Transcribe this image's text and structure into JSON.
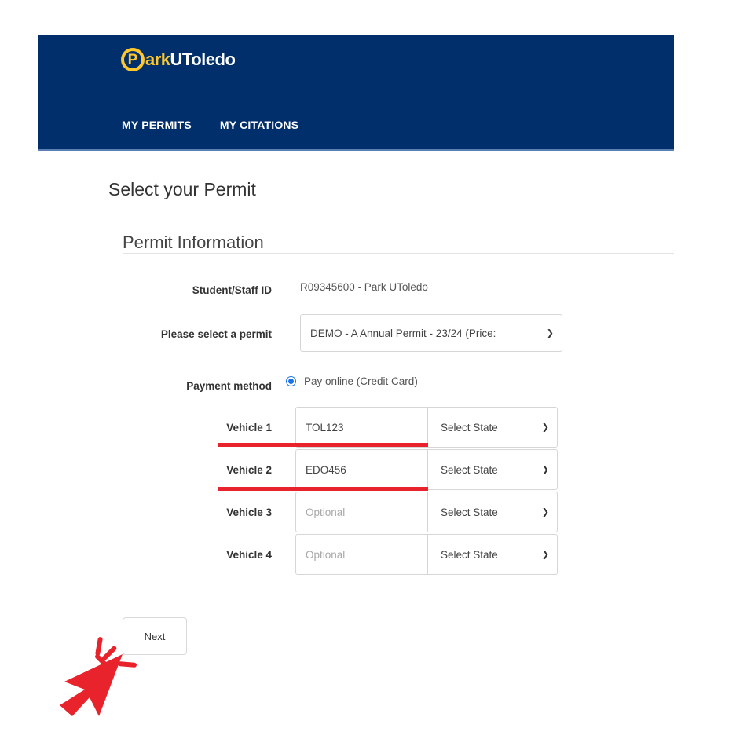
{
  "header": {
    "logo_letter": "P",
    "logo_park": "ark",
    "logo_u": "UToledo",
    "nav": [
      {
        "label": "MY PERMITS"
      },
      {
        "label": "MY CITATIONS"
      }
    ]
  },
  "page": {
    "title": "Select your Permit",
    "section_title": "Permit Information"
  },
  "form": {
    "id_label": "Student/Staff ID",
    "id_value": "R09345600 - Park UToledo",
    "permit_label": "Please select a permit",
    "permit_value": "DEMO - A Annual Permit - 23/24 (Price:",
    "payment_label": "Payment method",
    "payment_option": "Pay online (Credit Card)",
    "vehicles": [
      {
        "label": "Vehicle 1",
        "plate": "TOL123",
        "state": "Select State"
      },
      {
        "label": "Vehicle 2",
        "plate": "EDO456",
        "state": "Select State"
      },
      {
        "label": "Vehicle 3",
        "placeholder": "Optional",
        "state": "Select State"
      },
      {
        "label": "Vehicle 4",
        "placeholder": "Optional",
        "state": "Select State"
      }
    ]
  },
  "actions": {
    "next_label": "Next"
  },
  "colors": {
    "header_bg": "#002f6c",
    "logo_gold": "#ffc72c",
    "highlight_red": "#e8232b",
    "radio_blue": "#1a73e8"
  }
}
